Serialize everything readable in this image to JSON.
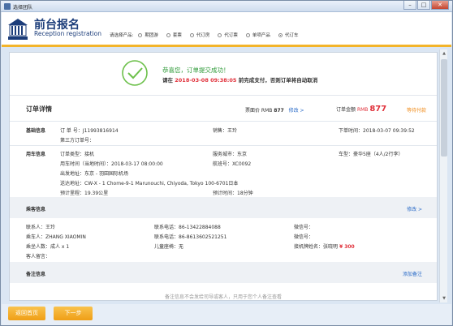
{
  "window": {
    "title": "选择团队"
  },
  "header": {
    "title": "前台报名",
    "subtitle": "Reception registration",
    "product_label": "请选择产品:",
    "products": [
      "期团游",
      "套票",
      "代订房",
      "代订票",
      "单项产品",
      "代订车"
    ],
    "selected_product": "代订车"
  },
  "success": {
    "title": "恭喜您，订单提交成功！",
    "note_prefix": "请在",
    "deadline": "2018-03-08 09:38:05",
    "note_suffix": "前完成支付，否则订单将自动取消"
  },
  "order": {
    "title": "订单详情",
    "fare_label": "票面价 RMB",
    "fare_value": "877",
    "edit": "修改 >",
    "total_label": "订单金额",
    "total_currency": "RMB",
    "total_value": "877",
    "wait": "等待付款"
  },
  "basic": {
    "label": "基础信息",
    "order_no": "订 单 号：J11993816914",
    "sales": "销售：王玲",
    "order_time": "下单时间：2018-03-07 09:39:52",
    "third_party": "第三方订单号："
  },
  "car": {
    "label": "用车信息",
    "type": "订单类型：接机",
    "city": "服务城市：东京",
    "car_type": "车型：豪华5座（4人/2行李）",
    "use_time": "用车时间（当地时间）：2018-03-17 08:00:00",
    "flight": "航班号：XC0092",
    "from": "出发地址：东京 - 羽田国际机场",
    "to": "送达地址：CW-X - 1 Chome-9-1 Marunouchi, Chiyoda, Tokyo 100-6701日本",
    "distance": "预计里程：19.39公里",
    "duration": "预计时间：18分钟"
  },
  "passenger": {
    "label": "乘客信息",
    "edit": "修改 >",
    "contact": "联系人：王玲",
    "contact_phone": "联系电话：86-13422884088",
    "wechat1": "微信号：",
    "rider": "乘车人：ZHANG XIAOMIN",
    "rider_phone": "联系电话：86-8613602521251",
    "wechat2": "微信号：",
    "count": "乘坐人数：成人 x 1",
    "child_seat": "儿童座椅：无",
    "sign_label": "接机牌姓名：张晓明",
    "sign_price": "¥ 300",
    "message": "客人留言："
  },
  "remark": {
    "label": "备注信息",
    "add": "添加备注",
    "placeholder": "备注信息不会发给司导或客人，只用于您个人备注查看"
  },
  "footer": {
    "back": "返回首页",
    "next": "下一步"
  },
  "colors": {
    "accent": "#f3b42a",
    "brand": "#1c3d7a",
    "price": "#e0303a",
    "success": "#2e9a38",
    "link": "#2a6bc8"
  }
}
